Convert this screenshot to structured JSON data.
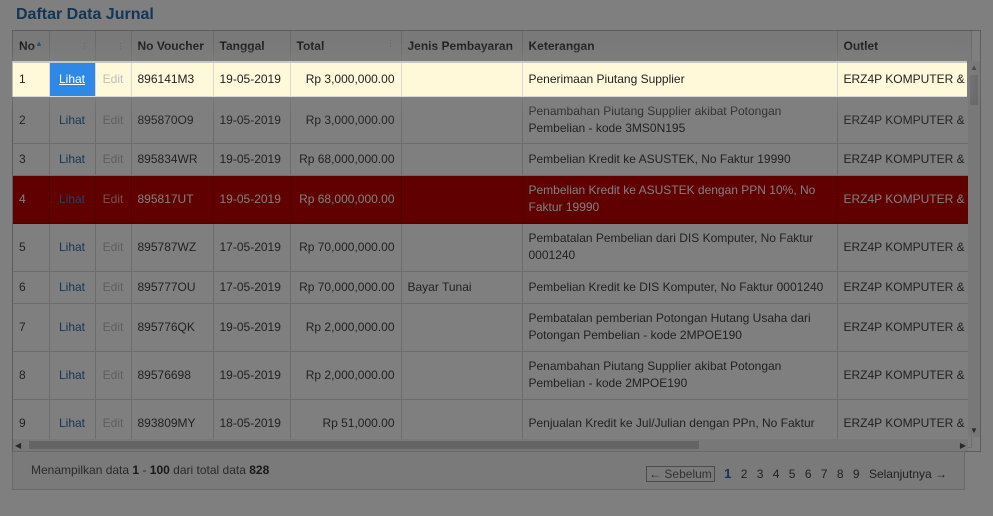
{
  "page_title": "Daftar Data Jurnal",
  "columns": [
    "No",
    "",
    "",
    "No Voucher",
    "Tanggal",
    "Total",
    "Jenis Pembayaran",
    "Keterangan",
    "Outlet"
  ],
  "rows": [
    {
      "no": "1",
      "lihat": "Lihat",
      "edit": "Edit",
      "voucher": "896141M3",
      "tanggal": "19-05-2019",
      "total": "Rp 3,000,000.00",
      "jenis": "",
      "keterangan": "Penerimaan Piutang Supplier",
      "outlet": "ERZ4P KOMPUTER &"
    },
    {
      "no": "2",
      "lihat": "Lihat",
      "edit": "Edit",
      "voucher": "895870O9",
      "tanggal": "19-05-2019",
      "total": "Rp 3,000,000.00",
      "jenis": "",
      "keterangan": "Penambahan Piutang Supplier akibat Potongan Pembelian - kode 3MS0N195",
      "outlet": "ERZ4P KOMPUTER &"
    },
    {
      "no": "3",
      "lihat": "Lihat",
      "edit": "Edit",
      "voucher": "895834WR",
      "tanggal": "19-05-2019",
      "total": "Rp 68,000,000.00",
      "jenis": "",
      "keterangan": "Pembelian Kredit ke ASUSTEK, No Faktur 19990",
      "outlet": "ERZ4P KOMPUTER &"
    },
    {
      "no": "4",
      "lihat": "Lihat",
      "edit": "Edit",
      "voucher": "895817UT",
      "tanggal": "19-05-2019",
      "total": "Rp 68,000,000.00",
      "jenis": "",
      "keterangan": "Pembelian Kredit ke ASUSTEK dengan PPN 10%, No Faktur 19990",
      "outlet": "ERZ4P KOMPUTER &"
    },
    {
      "no": "5",
      "lihat": "Lihat",
      "edit": "Edit",
      "voucher": "895787WZ",
      "tanggal": "17-05-2019",
      "total": "Rp 70,000,000.00",
      "jenis": "",
      "keterangan": "Pembatalan Pembelian dari DIS Komputer, No Faktur 0001240",
      "outlet": "ERZ4P KOMPUTER &"
    },
    {
      "no": "6",
      "lihat": "Lihat",
      "edit": "Edit",
      "voucher": "895777OU",
      "tanggal": "17-05-2019",
      "total": "Rp 70,000,000.00",
      "jenis": "Bayar Tunai",
      "keterangan": "Pembelian Kredit ke DIS Komputer, No Faktur 0001240",
      "outlet": "ERZ4P KOMPUTER &"
    },
    {
      "no": "7",
      "lihat": "Lihat",
      "edit": "Edit",
      "voucher": "895776QK",
      "tanggal": "19-05-2019",
      "total": "Rp 2,000,000.00",
      "jenis": "",
      "keterangan": "Pembatalan pemberian Potongan Hutang Usaha dari Potongan Pembelian - kode 2MPOE190",
      "outlet": "ERZ4P KOMPUTER &"
    },
    {
      "no": "8",
      "lihat": "Lihat",
      "edit": "Edit",
      "voucher": "89576698",
      "tanggal": "19-05-2019",
      "total": "Rp 2,000,000.00",
      "jenis": "",
      "keterangan": "Penambahan Piutang Supplier akibat Potongan Pembelian - kode 2MPOE190",
      "outlet": "ERZ4P KOMPUTER &"
    },
    {
      "no": "9",
      "lihat": "Lihat",
      "edit": "Edit",
      "voucher": "893809MY",
      "tanggal": "18-05-2019",
      "total": "Rp 51,000.00",
      "jenis": "",
      "keterangan": "Penjualan Kredit ke Jul/Julian dengan PPn, No Faktur",
      "outlet": "ERZ4P KOMPUTER &"
    }
  ],
  "footer": {
    "info_prefix": "Menampilkan data",
    "range_start": "1",
    "range_sep": "-",
    "range_end": "100",
    "info_mid": "dari total data",
    "total": "828",
    "prev": "← Sebelum",
    "pages": [
      "1",
      "2",
      "3",
      "4",
      "5",
      "6",
      "7",
      "8",
      "9"
    ],
    "next": "Selanjutnya →"
  },
  "colors": {
    "accent": "#2a6aaf",
    "selected_row": "#fff9d9",
    "red_row": "#c00000",
    "lihat_highlight": "#2d89e5"
  }
}
